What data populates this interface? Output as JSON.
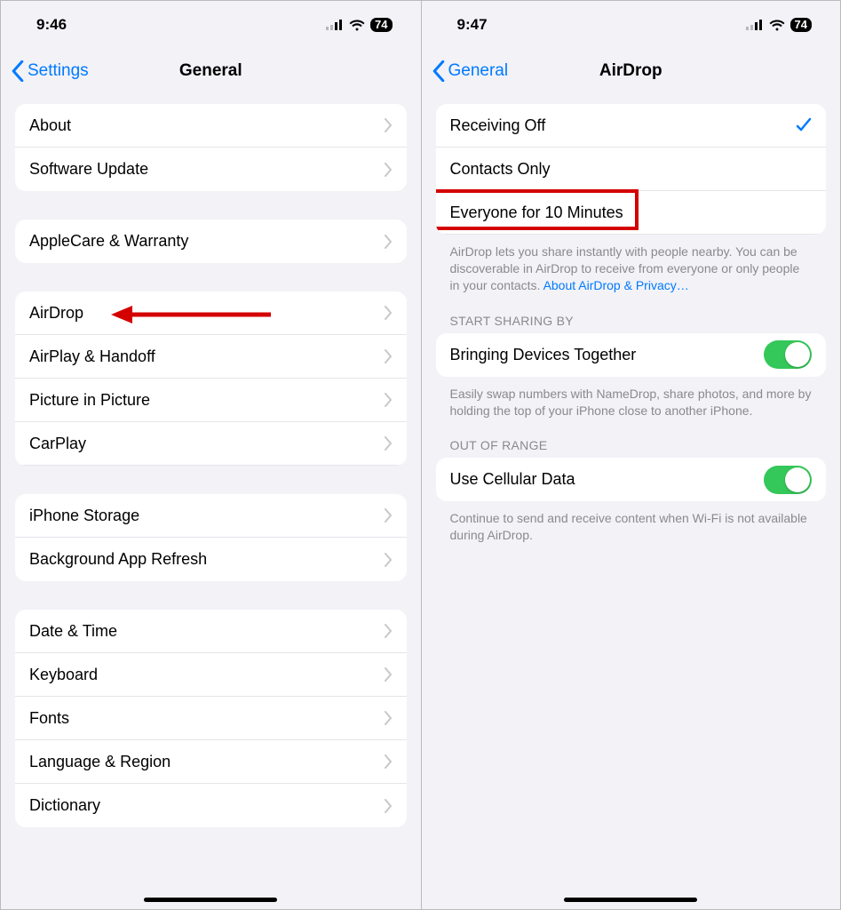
{
  "left": {
    "status": {
      "time": "9:46",
      "battery": "74"
    },
    "nav": {
      "back": "Settings",
      "title": "General"
    },
    "groups": [
      {
        "rows": [
          {
            "label": "About"
          },
          {
            "label": "Software Update"
          }
        ]
      },
      {
        "rows": [
          {
            "label": "AppleCare & Warranty"
          }
        ]
      },
      {
        "rows": [
          {
            "label": "AirDrop"
          },
          {
            "label": "AirPlay & Handoff"
          },
          {
            "label": "Picture in Picture"
          },
          {
            "label": "CarPlay"
          }
        ]
      },
      {
        "rows": [
          {
            "label": "iPhone Storage"
          },
          {
            "label": "Background App Refresh"
          }
        ]
      },
      {
        "rows": [
          {
            "label": "Date & Time"
          },
          {
            "label": "Keyboard"
          },
          {
            "label": "Fonts"
          },
          {
            "label": "Language & Region"
          },
          {
            "label": "Dictionary"
          }
        ]
      }
    ]
  },
  "right": {
    "status": {
      "time": "9:47",
      "battery": "74"
    },
    "nav": {
      "back": "General",
      "title": "AirDrop"
    },
    "receiving": {
      "rows": [
        {
          "label": "Receiving Off",
          "selected": true
        },
        {
          "label": "Contacts Only"
        },
        {
          "label": "Everyone for 10 Minutes",
          "highlight": true
        }
      ],
      "footer_text": "AirDrop lets you share instantly with people nearby. You can be discoverable in AirDrop to receive from everyone or only people in your contacts. ",
      "footer_link": "About AirDrop & Privacy…"
    },
    "start_sharing": {
      "header": "START SHARING BY",
      "row_label": "Bringing Devices Together",
      "footer": "Easily swap numbers with NameDrop, share photos, and more by holding the top of your iPhone close to another iPhone."
    },
    "out_of_range": {
      "header": "OUT OF RANGE",
      "row_label": "Use Cellular Data",
      "footer": "Continue to send and receive content when Wi-Fi is not available during AirDrop."
    }
  }
}
